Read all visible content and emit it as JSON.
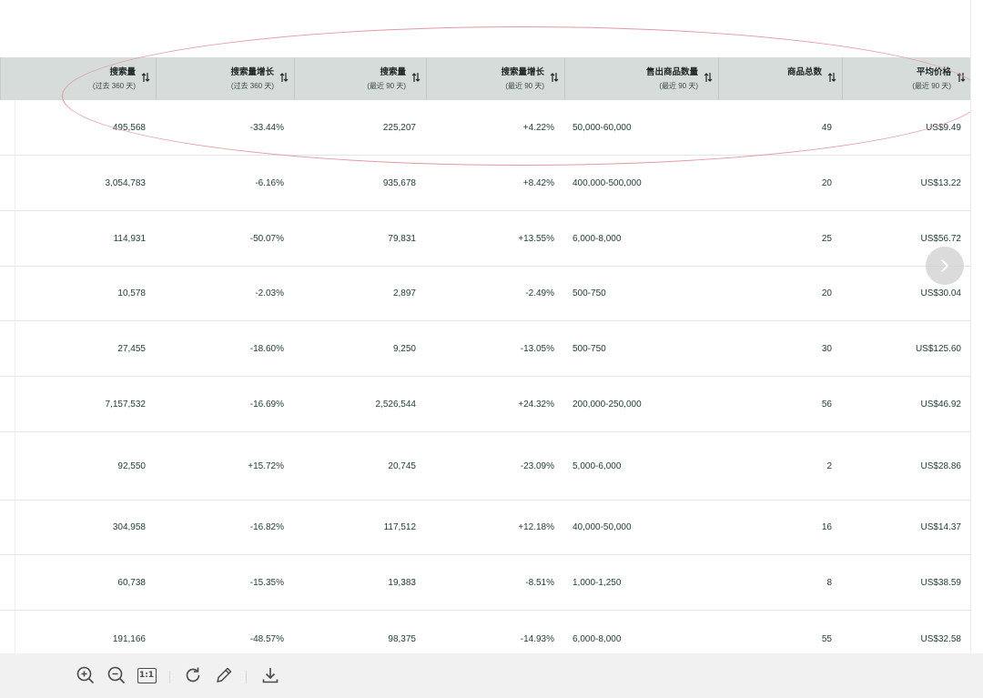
{
  "columns": [
    {
      "title": "搜索量",
      "sub": "(过去 360 天)"
    },
    {
      "title": "搜索量增长",
      "sub": "(过去 360 天)"
    },
    {
      "title": "搜索量",
      "sub": "(最近 90 天)"
    },
    {
      "title": "搜索量增长",
      "sub": "(最近 90 天)"
    },
    {
      "title": "售出商品数量",
      "sub": "(最近 90 天)"
    },
    {
      "title": "商品总数",
      "sub": ""
    },
    {
      "title": "平均价格",
      "sub": "(最近 90 天)"
    }
  ],
  "rows": [
    [
      "495,568",
      "-33.44%",
      "225,207",
      "+4.22%",
      "50,000-60,000",
      "49",
      "US$9.49"
    ],
    [
      "3,054,783",
      "-6.16%",
      "935,678",
      "+8.42%",
      "400,000-500,000",
      "20",
      "US$13.22"
    ],
    [
      "114,931",
      "-50.07%",
      "79,831",
      "+13.55%",
      "6,000-8,000",
      "25",
      "US$56.72"
    ],
    [
      "10,578",
      "-2.03%",
      "2,897",
      "-2.49%",
      "500-750",
      "20",
      "US$30.04"
    ],
    [
      "27,455",
      "-18.60%",
      "9,250",
      "-13.05%",
      "500-750",
      "30",
      "US$125.60"
    ],
    [
      "7,157,532",
      "-16.69%",
      "2,526,544",
      "+24.32%",
      "200,000-250,000",
      "56",
      "US$46.92"
    ],
    [
      "92,550",
      "+15.72%",
      "20,745",
      "-23.09%",
      "5,000-6,000",
      "2",
      "US$28.86"
    ],
    [
      "304,958",
      "-16.82%",
      "117,512",
      "+12.18%",
      "40,000-50,000",
      "16",
      "US$14.37"
    ],
    [
      "60,738",
      "-15.35%",
      "19,383",
      "-8.51%",
      "1,000-1,250",
      "8",
      "US$38.59"
    ],
    [
      "191,166",
      "-48.57%",
      "98,375",
      "-14.93%",
      "6,000-8,000",
      "55",
      "US$32.58"
    ]
  ],
  "toolbar": {
    "actual_size_label": "1:1",
    "icons": [
      "zoom-in-icon",
      "zoom-out-icon",
      "actual-size-icon",
      "rotate-icon",
      "edit-pen-icon",
      "download-icon"
    ]
  },
  "colors": {
    "header_bg": "#d6dcda",
    "text": "#1f3a36",
    "annotation_ellipse": "#e29aa3",
    "toolbar_bg": "#f1f1f1"
  }
}
